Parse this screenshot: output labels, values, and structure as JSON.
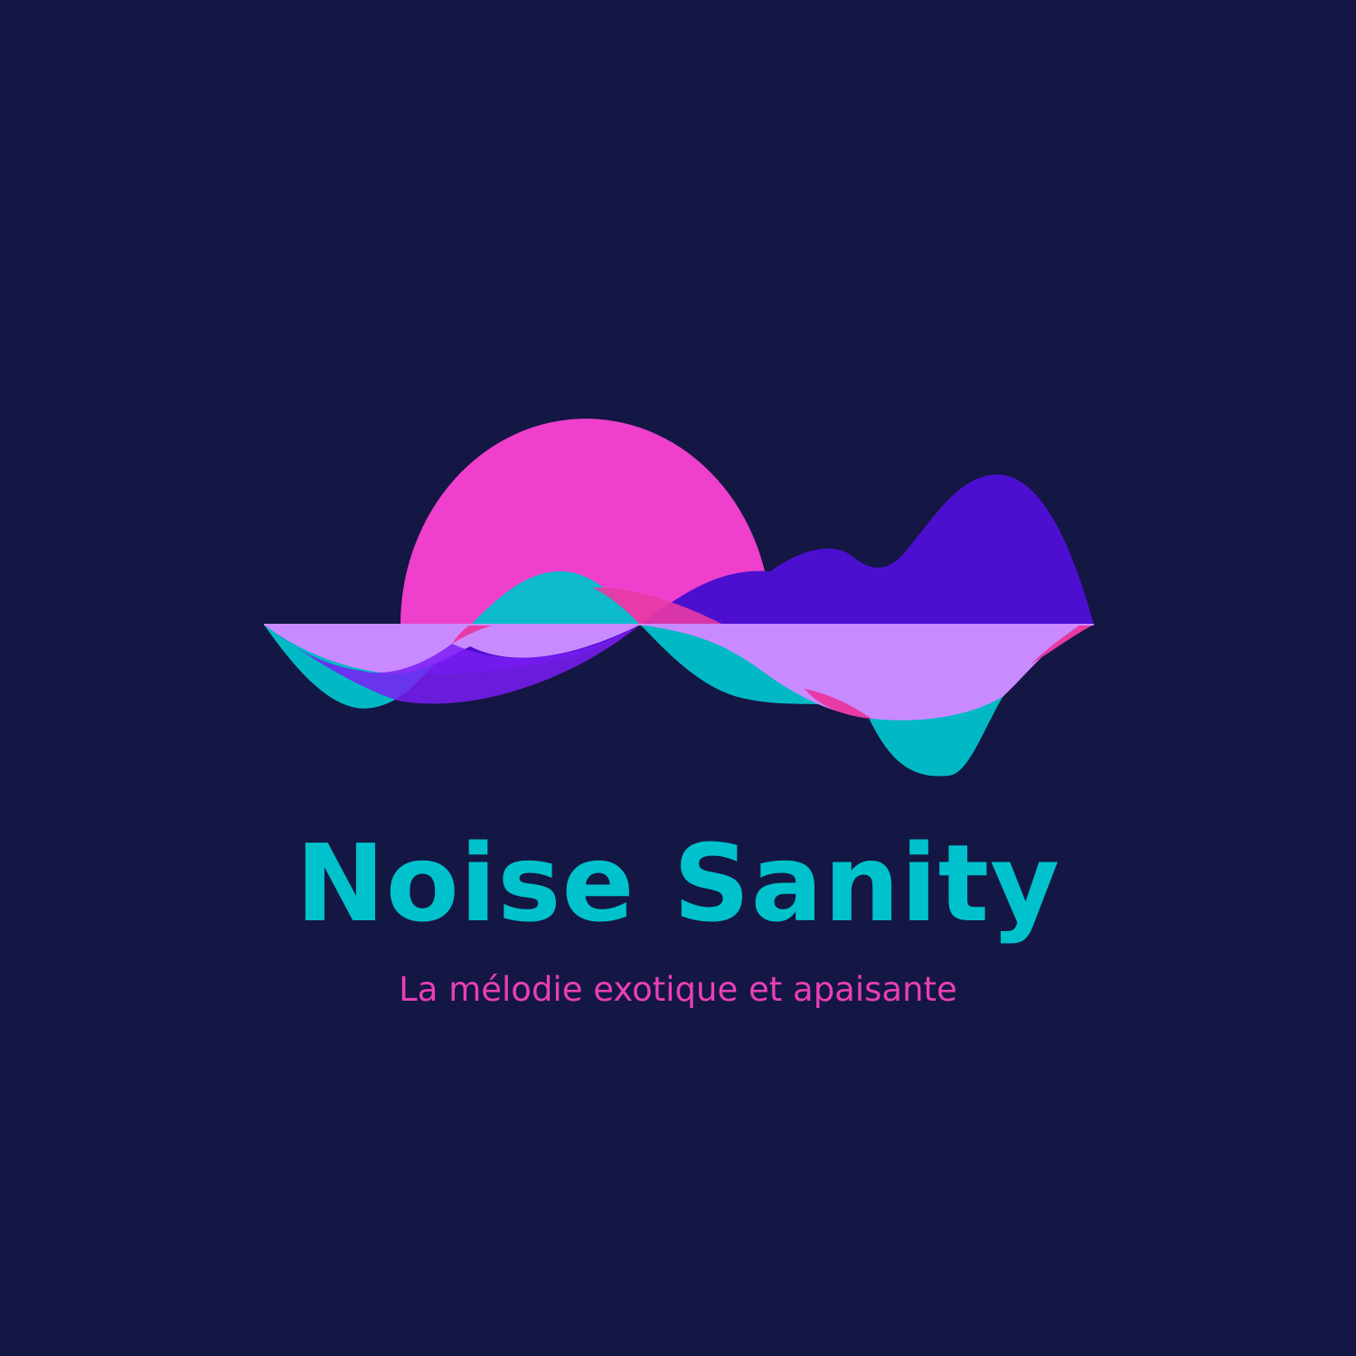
{
  "brand": {
    "name": "Noise Sanity",
    "tagline": "La mélodie exotique et apaisante"
  },
  "colors": {
    "background": "#141643",
    "name": "#00c2cc",
    "tagline": "#e83fb6",
    "sun": "#ee40cc",
    "teal_wave": "#00c2cc",
    "violet_wave": "#4c0fcf",
    "lavender_reflection": "#c98aff",
    "pink_overlap": "#e73aa4"
  },
  "icons": [
    "sun-icon",
    "sound-wave-icon"
  ]
}
